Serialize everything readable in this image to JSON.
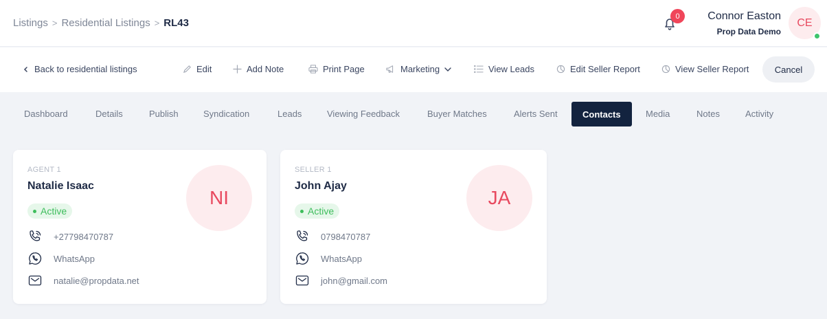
{
  "breadcrumb": {
    "items": [
      "Listings",
      "Residential Listings"
    ],
    "current": "RL43",
    "separator": ">"
  },
  "notifications": {
    "count": "0"
  },
  "user": {
    "name": "Connor Easton",
    "company": "Prop Data Demo",
    "initials": "CE"
  },
  "toolbar": {
    "back": "Back to residential listings",
    "edit": "Edit",
    "add_note": "Add Note",
    "print_page": "Print Page",
    "marketing": "Marketing",
    "view_leads": "View Leads",
    "edit_seller_report": "Edit Seller Report",
    "view_seller_report": "View Seller Report",
    "cancel": "Cancel"
  },
  "tabs": [
    "Dashboard",
    "Details",
    "Publish",
    "Syndication",
    "Leads",
    "Viewing Feedback",
    "Buyer Matches",
    "Alerts Sent",
    "Contacts",
    "Media",
    "Notes",
    "Activity"
  ],
  "active_tab": "Contacts",
  "contacts": [
    {
      "role": "AGENT 1",
      "name": "Natalie Isaac",
      "status": "Active",
      "initials": "NI",
      "phone": "+27798470787",
      "whatsapp": "WhatsApp",
      "email": "natalie@propdata.net"
    },
    {
      "role": "SELLER 1",
      "name": "John Ajay",
      "status": "Active",
      "initials": "JA",
      "phone": "0798470787",
      "whatsapp": "WhatsApp",
      "email": "john@gmail.com"
    }
  ],
  "colors": {
    "accent_navy": "#13233f",
    "avatar_text": "#e8495f",
    "status_green": "#3ebd5c",
    "badge_red": "#f0465a"
  }
}
